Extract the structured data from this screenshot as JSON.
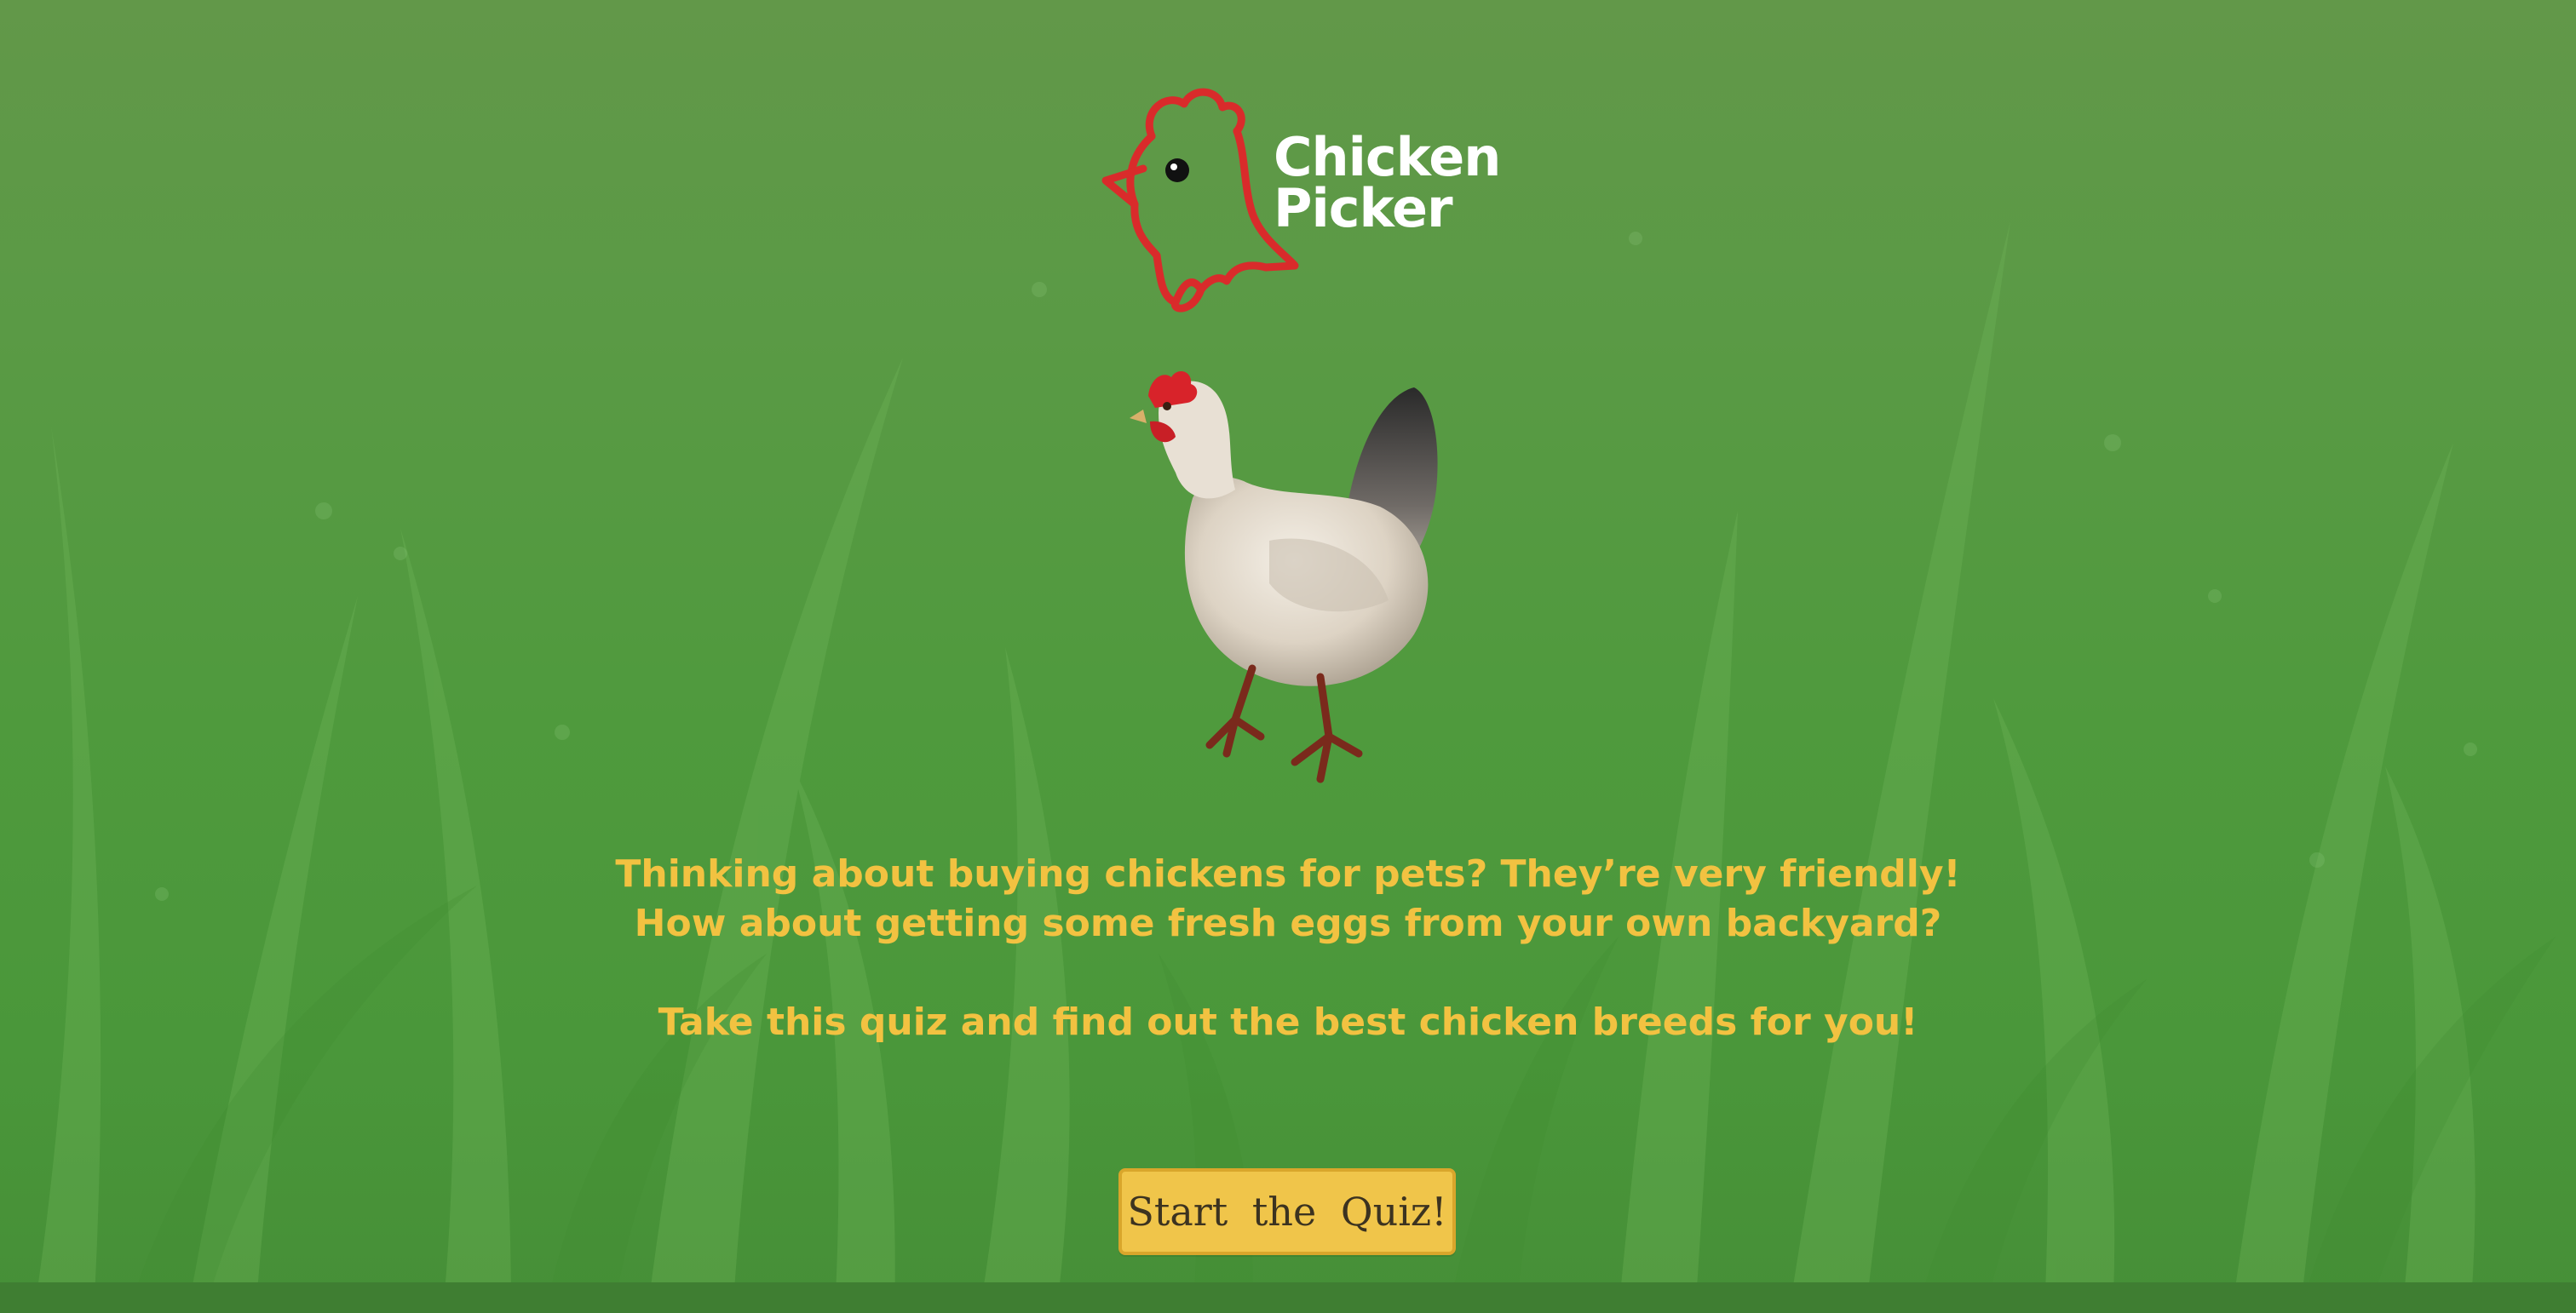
{
  "logo": {
    "line1": "Chicken",
    "line2": "Picker",
    "icon": "chicken-head-outline",
    "icon_color": "#d92b2b"
  },
  "hero_image": {
    "icon": "hen-illustration"
  },
  "intro": {
    "line1": "Thinking about buying chickens for pets? They’re very friendly!",
    "line2": "How about getting some fresh eggs from your own backyard?",
    "line3": "Take this quiz and find out the best chicken breeds for you!",
    "text_color": "#f2c241"
  },
  "start_button": {
    "label": "Start the Quiz!",
    "color": "#f0c54a"
  },
  "background": {
    "icon": "grass-field",
    "color": "#5c9a48"
  }
}
